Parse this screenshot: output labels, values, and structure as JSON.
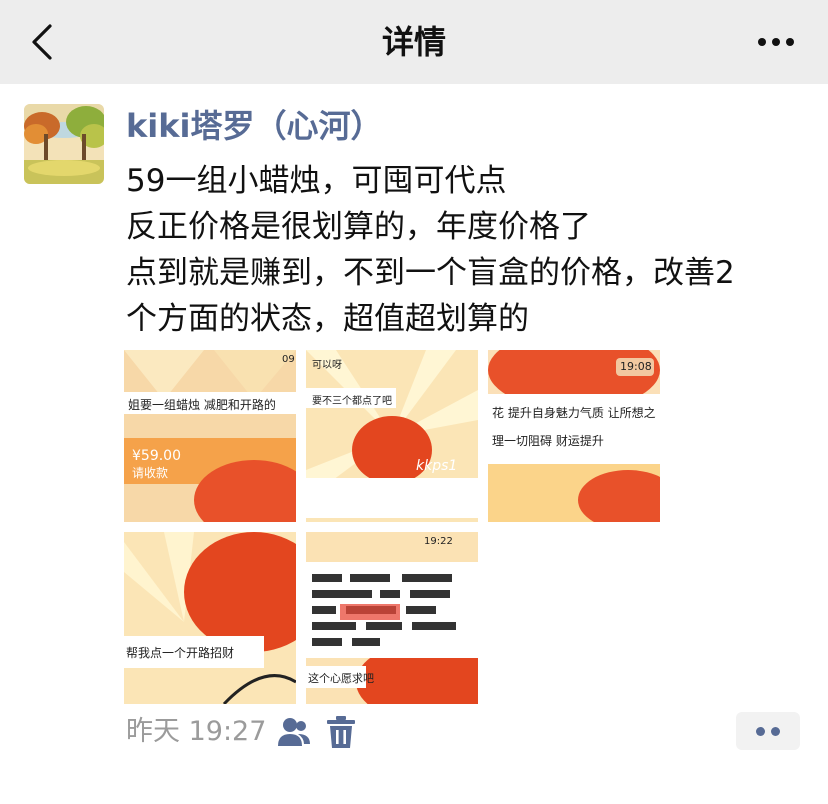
{
  "navbar": {
    "title": "详情",
    "back_icon": "chevron-left-icon",
    "more_icon": "more-dots-icon"
  },
  "post": {
    "username": "kiki塔罗（心河）",
    "lines": [
      "59一组小蜡烛，可囤可代点",
      "反正价格是很划算的，年度价格了",
      "点到就是赚到，不到一个盲盒的价格，改善2",
      "个方面的状态，超值超划算的"
    ],
    "photos": [
      {
        "text_a": "姐要一组蜡烛 减肥和开路的",
        "text_b": "¥59.00",
        "text_c": "请收款",
        "time": "09"
      },
      {
        "text_a": "可以呀",
        "text_b": "要不三个都点了吧",
        "text_c": "kkps1"
      },
      {
        "text_a": "花 提升自身魅力气质 让所想之",
        "text_b": "理一切阻碍 财运提升",
        "time": "19:08"
      },
      {
        "text_a": "帮我点一个开路招财"
      },
      {
        "text_a": "这个心愿求吧",
        "time": "19:22"
      }
    ],
    "timestamp": "昨天 19:27"
  },
  "colors": {
    "link": "#576b95",
    "navbar_bg": "#ededed",
    "muted": "#9b9b9b"
  }
}
